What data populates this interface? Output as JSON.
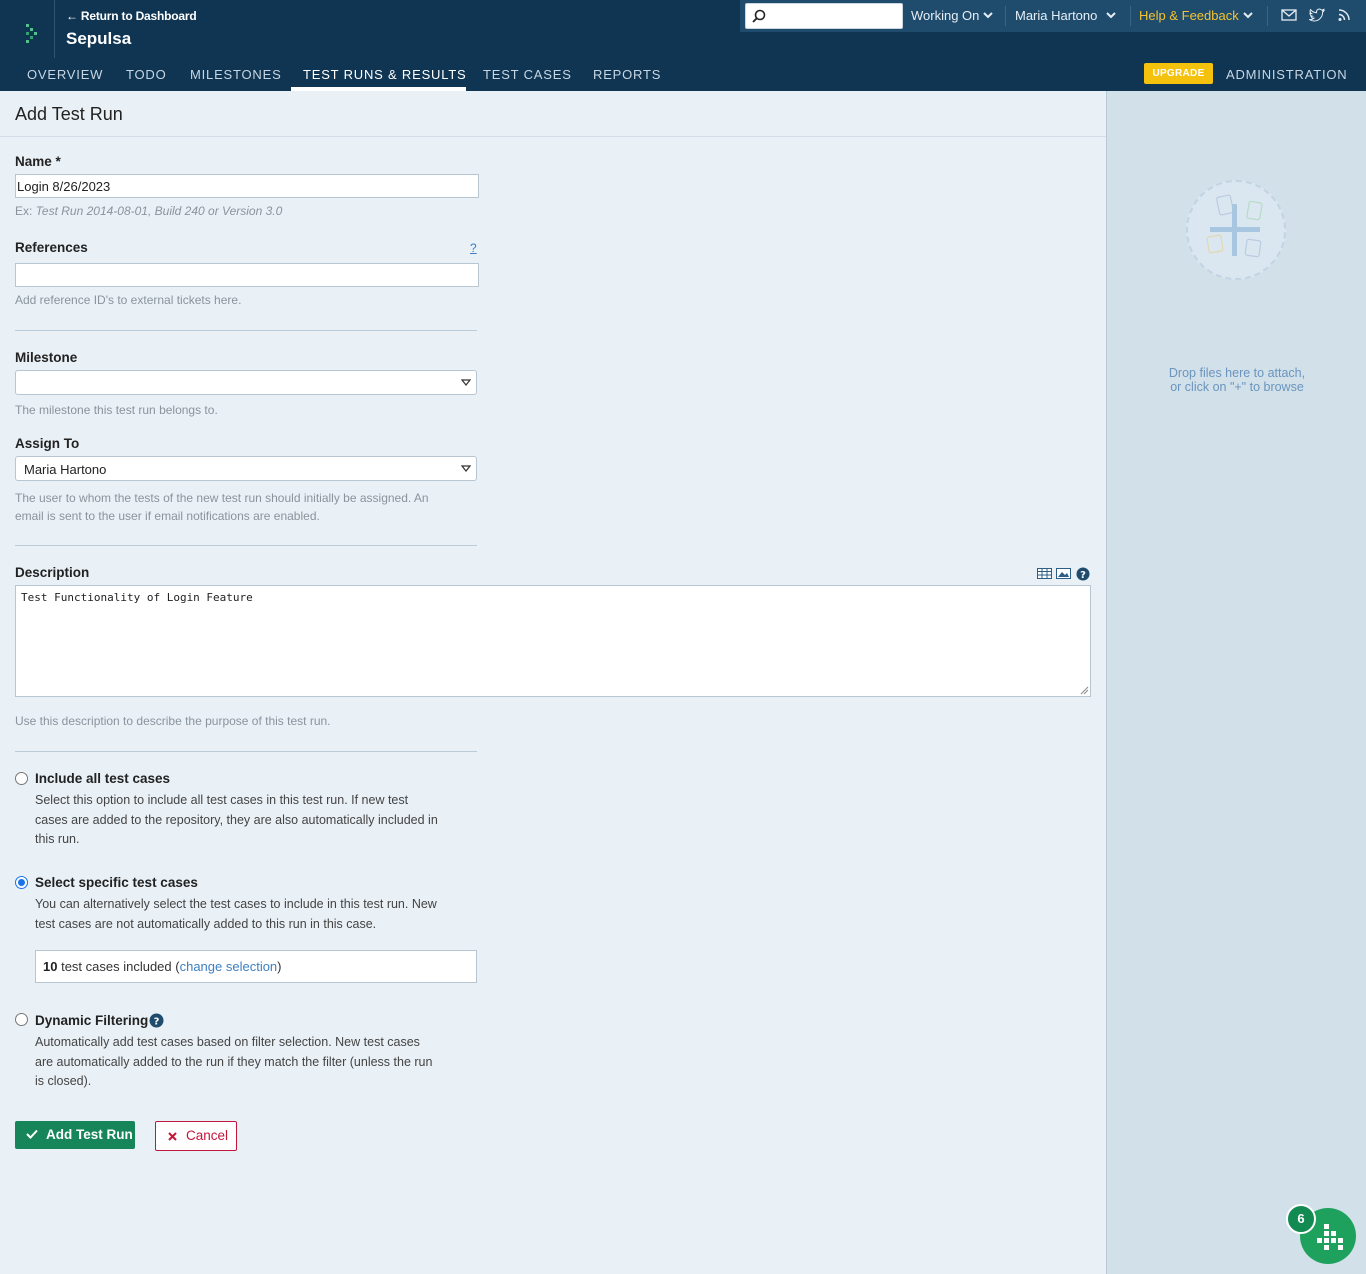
{
  "header": {
    "return_link": "← Return to Dashboard",
    "project_name": "Sepulsa",
    "search": {
      "placeholder": "",
      "value": ""
    },
    "working_on": "Working On",
    "user_name": "Maria Hartono",
    "help": "Help & Feedback",
    "icons": [
      "mail-icon",
      "twitter-icon",
      "rss-icon"
    ],
    "colors": {
      "bar": "#0f3553",
      "help": "#f4c430",
      "upgrade": "#f4c20d"
    }
  },
  "nav": {
    "tabs": [
      {
        "label": "OVERVIEW"
      },
      {
        "label": "TODO"
      },
      {
        "label": "MILESTONES"
      },
      {
        "label": "TEST RUNS & RESULTS",
        "active": true
      },
      {
        "label": "TEST CASES"
      },
      {
        "label": "REPORTS"
      }
    ],
    "upgrade": "UPGRADE",
    "administration": "ADMINISTRATION"
  },
  "form": {
    "title": "Add Test Run",
    "name": {
      "label": "Name *",
      "value": "Login 8/26/2023",
      "hint_prefix": "Ex: ",
      "hint_example": "Test Run 2014-08-01, Build 240 or Version 3.0"
    },
    "references": {
      "label": "References",
      "help_link": "?",
      "value": "",
      "hint": "Add reference ID's to external tickets here."
    },
    "milestone": {
      "label": "Milestone",
      "value": "",
      "hint": "The milestone this test run belongs to."
    },
    "assign_to": {
      "label": "Assign To",
      "value": "Maria Hartono",
      "hint_line1": "The user to whom the tests of the new test run should initially be assigned. An",
      "hint_line2": "email is sent to the user if email notifications are enabled."
    },
    "description": {
      "label": "Description",
      "value": "Test Functionality of Login Feature",
      "hint": "Use this description to describe the purpose of this test run.",
      "toolbar_icons": [
        "table-icon",
        "image-icon",
        "help-icon"
      ]
    },
    "options": {
      "include_all": {
        "title": "Include all test cases",
        "line1": "Select this option to include all test cases in this test run. If new test",
        "line2": "cases are added to the repository, they are also automatically included in",
        "line3": "this run.",
        "checked": false
      },
      "select_specific": {
        "title": "Select specific test cases",
        "line1": "You can alternatively select the test cases to include in this test run. New",
        "line2": "test cases are not automatically added to this run in this case.",
        "checked": true,
        "count": "10",
        "count_text": " test cases included (",
        "change_link": "change selection",
        "close_paren": ")"
      },
      "dynamic_filtering": {
        "title": "Dynamic Filtering",
        "line1": "Automatically add test cases based on filter selection. New test cases",
        "line2": "are automatically added to the run if they match the filter (unless the run",
        "line3": "is closed).",
        "checked": false
      }
    },
    "buttons": {
      "add": "Add Test Run",
      "cancel": "Cancel"
    }
  },
  "sidebar": {
    "drop_line1": "Drop files here to attach,",
    "drop_line2": "or click on \"+\" to browse"
  },
  "widget": {
    "badge": "6"
  }
}
